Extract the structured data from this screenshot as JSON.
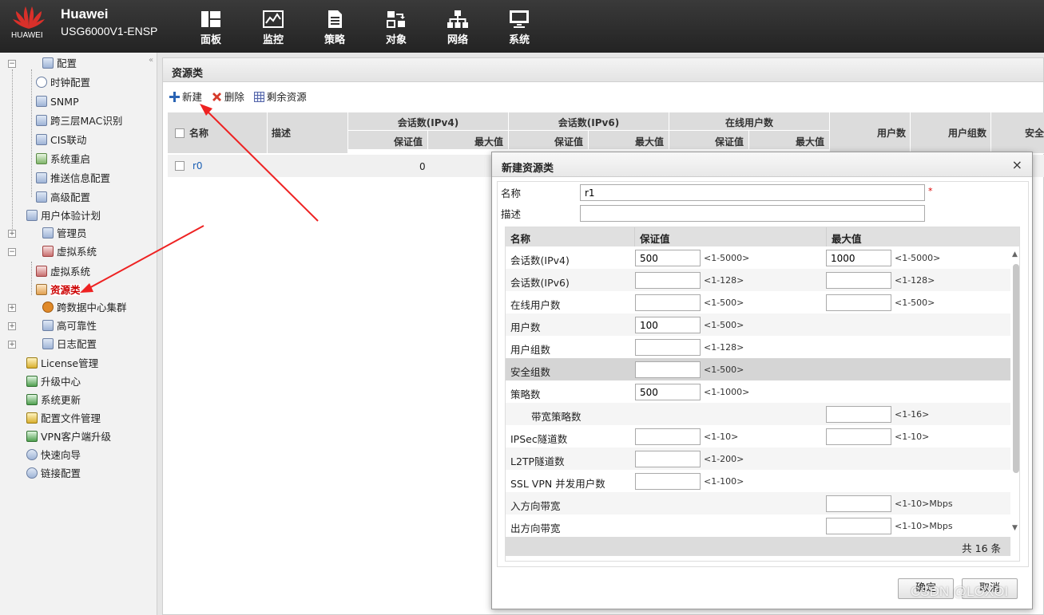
{
  "brand": {
    "logo_text": "HUAWEI",
    "name": "Huawei",
    "model": "USG6000V1-ENSP"
  },
  "nav": [
    {
      "label": "面板",
      "icon": "dashboard-icon"
    },
    {
      "label": "监控",
      "icon": "monitor-chart-icon"
    },
    {
      "label": "策略",
      "icon": "document-icon"
    },
    {
      "label": "对象",
      "icon": "object-icon"
    },
    {
      "label": "网络",
      "icon": "network-tree-icon"
    },
    {
      "label": "系统",
      "icon": "computer-icon",
      "active": true
    }
  ],
  "sidebar": {
    "collapse": "«",
    "items": [
      {
        "label": "配置",
        "icon": "config-icon",
        "expand": "−"
      },
      {
        "label": "时钟配置",
        "icon": "clock-icon"
      },
      {
        "label": "SNMP",
        "icon": "snmp-icon"
      },
      {
        "label": "跨三层MAC识别",
        "icon": "mac-icon"
      },
      {
        "label": "CIS联动",
        "icon": "cis-icon"
      },
      {
        "label": "系统重启",
        "icon": "restart-icon"
      },
      {
        "label": "推送信息配置",
        "icon": "push-icon"
      },
      {
        "label": "高级配置",
        "icon": "advanced-icon"
      },
      {
        "label": "用户体验计划",
        "icon": "user-experience-icon"
      },
      {
        "label": "管理员",
        "icon": "admin-icon",
        "expand": "+"
      },
      {
        "label": "虚拟系统",
        "icon": "vsys-icon",
        "expand": "−"
      },
      {
        "label": "虚拟系统",
        "icon": "vsys-icon"
      },
      {
        "label": "资源类",
        "icon": "resource-icon",
        "selected": true
      },
      {
        "label": "跨数据中心集群",
        "icon": "cluster-icon",
        "expand": "+"
      },
      {
        "label": "高可靠性",
        "icon": "ha-icon",
        "expand": "+"
      },
      {
        "label": "日志配置",
        "icon": "log-icon",
        "expand": "+"
      },
      {
        "label": "License管理",
        "icon": "license-icon"
      },
      {
        "label": "升级中心",
        "icon": "upgrade-icon"
      },
      {
        "label": "系统更新",
        "icon": "update-icon"
      },
      {
        "label": "配置文件管理",
        "icon": "file-icon"
      },
      {
        "label": "VPN客户端升级",
        "icon": "vpn-icon"
      },
      {
        "label": "快速向导",
        "icon": "wizard-icon"
      },
      {
        "label": "链接配置",
        "icon": "link-icon"
      }
    ]
  },
  "main": {
    "title": "资源类",
    "toolbar": {
      "new": "新建",
      "delete": "删除",
      "remaining": "剩余资源"
    },
    "grid": {
      "headers": {
        "name": "名称",
        "desc": "描述",
        "sess4": "会话数(IPv4)",
        "sess6": "会话数(IPv6)",
        "online": "在线用户数",
        "guarantee": "保证值",
        "max": "最大值",
        "users": "用户数",
        "groups": "用户组数",
        "security": "安全"
      },
      "rows": [
        {
          "name": "r0",
          "value": "0"
        }
      ]
    }
  },
  "dialog": {
    "title": "新建资源类",
    "close": "×",
    "name_label": "名称",
    "name_value": "r1",
    "required": "*",
    "desc_label": "描述",
    "desc_value": "",
    "table": {
      "headers": {
        "name": "名称",
        "guarantee": "保证值",
        "max": "最大值"
      },
      "rows": [
        {
          "name": "会话数(IPv4)",
          "g": "500",
          "gr": "<1-5000>",
          "m": "1000",
          "mr": "<1-5000>"
        },
        {
          "name": "会话数(IPv6)",
          "g": "",
          "gr": "<1-128>",
          "m": "",
          "mr": "<1-128>"
        },
        {
          "name": "在线用户数",
          "g": "",
          "gr": "<1-500>",
          "m": "",
          "mr": "<1-500>"
        },
        {
          "name": "用户数",
          "g": "100",
          "gr": "<1-500>"
        },
        {
          "name": "用户组数",
          "g": "",
          "gr": "<1-128>"
        },
        {
          "name": "安全组数",
          "g": "",
          "gr": "<1-500>",
          "hl": true
        },
        {
          "name": "策略数",
          "g": "500",
          "gr": "<1-1000>"
        },
        {
          "name": "带宽策略数",
          "indent": true,
          "m": "",
          "mr": "<1-16>"
        },
        {
          "name": "IPSec隧道数",
          "g": "",
          "gr": "<1-10>",
          "m": "",
          "mr": "<1-10>"
        },
        {
          "name": "L2TP隧道数",
          "g": "",
          "gr": "<1-200>"
        },
        {
          "name": "SSL VPN 并发用户数",
          "g": "",
          "gr": "<1-100>"
        },
        {
          "name": "入方向带宽",
          "m": "",
          "mr": "<1-10>Mbps"
        },
        {
          "name": "出方向带宽",
          "m": "",
          "mr": "<1-10>Mbps"
        }
      ],
      "footer": "共 16 条"
    },
    "ok": "确定",
    "cancel": "取消"
  },
  "watermark": "CSDN @LOXOI",
  "colors": {
    "topbar": "#2b2b2b",
    "accent_red": "#e0322d",
    "link_blue": "#1a5fb4"
  }
}
